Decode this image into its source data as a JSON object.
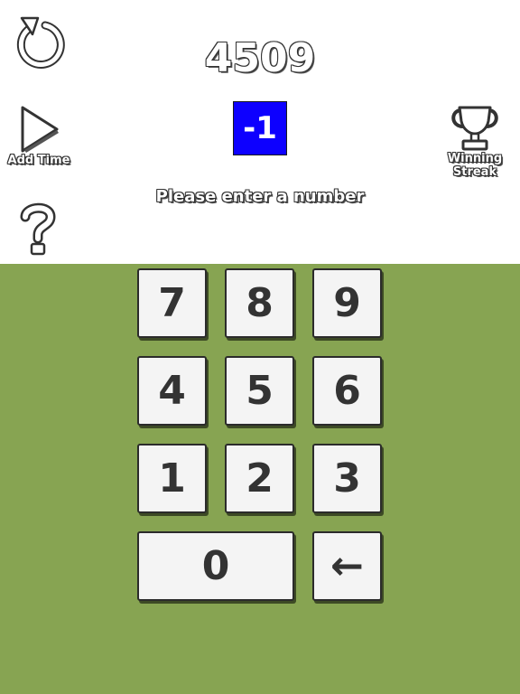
{
  "game": {
    "score": "4509",
    "target": "-1",
    "message": "Please enter a number"
  },
  "controls": {
    "restart_icon": "restart-icon",
    "add_time_label": "Add Time",
    "add_time_icon": "play-icon",
    "help_icon": "question-mark-icon",
    "streak_label": "Winning\nStreak",
    "streak_icon": "trophy-icon"
  },
  "keypad": {
    "keys": [
      "7",
      "8",
      "9",
      "4",
      "5",
      "6",
      "1",
      "2",
      "3",
      "0",
      "←"
    ]
  },
  "colors": {
    "pad_background": "#87a452",
    "target_background": "#0d00ff",
    "key_background": "#f4f4f4",
    "key_text": "#333333"
  }
}
